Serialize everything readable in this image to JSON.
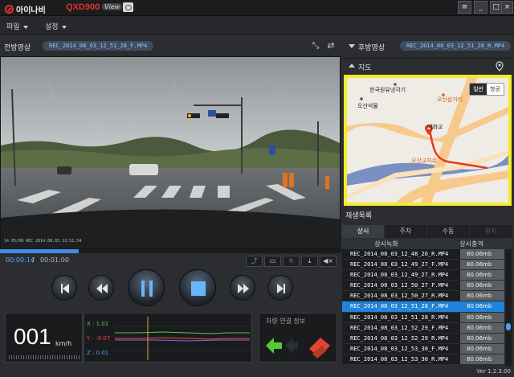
{
  "app": {
    "brand": "아이나비",
    "model": "QXD900",
    "model_suffix": "View",
    "version": "Ver 1.2.3.00"
  },
  "window_controls": {
    "menu": "≡",
    "minimize": "_",
    "maximize": "□",
    "close": "×"
  },
  "menu": {
    "file": "파일",
    "settings": "설정"
  },
  "front": {
    "label": "전방영상",
    "file": "REC_2014_08_03_12_51_28_F.MP4",
    "stamp": "14 05/08   REC 2014.08.03 12:51:34"
  },
  "playback": {
    "current": "00:00:14",
    "separator": "/",
    "total": "00:01:00",
    "progress": 0.23
  },
  "telemetry": {
    "speed": "001",
    "speed_unit": "km/h",
    "x": "X : 1.01",
    "y": "Y : -0.07",
    "z": "Z : 0.01",
    "vehicle_title": "차량 연결 정보"
  },
  "rear": {
    "label": "후방영상",
    "file": "REC_2014_08_03_12_51_28_R.MP4"
  },
  "map": {
    "label": "지도",
    "labels": {
      "place1": "한국원유냉각기",
      "place2": "오산석물",
      "place3": "오산삼거리",
      "place4": "예화교",
      "place5": "오산교차로"
    },
    "mode_normal": "일반",
    "mode_satellite": "항공",
    "colors": {
      "frame": "#f4eb2a",
      "route": "#e8391b",
      "water": "#7a8fc2",
      "road": "#f7c98b"
    }
  },
  "playlist": {
    "title": "재생목록",
    "tabs": [
      "상시",
      "주차",
      "수동",
      "위치"
    ],
    "columns": [
      "상시녹화",
      "상시충격"
    ],
    "rows": [
      {
        "name": "REC_2014_08_03_12_48_26_R.MP4",
        "size": "80.06mb"
      },
      {
        "name": "REC_2014_08_03_12_49_27_F.MP4",
        "size": "80.06mb"
      },
      {
        "name": "REC_2014_08_03_12_49_27_R.MP4",
        "size": "80.06mb"
      },
      {
        "name": "REC_2014_08_03_12_50_27_F.MP4",
        "size": "80.06mb"
      },
      {
        "name": "REC_2014_08_03_12_50_27_R.MP4",
        "size": "80.06mb"
      },
      {
        "name": "REC_2014_08_03_12_51_28_F.MP4",
        "size": "80.06mb"
      },
      {
        "name": "REC_2014_08_03_12_51_28_R.MP4",
        "size": "80.06mb"
      },
      {
        "name": "REC_2014_08_03_12_52_29_F.MP4",
        "size": "80.06mb"
      },
      {
        "name": "REC_2014_08_03_12_52_29_R.MP4",
        "size": "80.06mb"
      },
      {
        "name": "REC_2014_08_03_12_53_30_F.MP4",
        "size": "80.06mb"
      },
      {
        "name": "REC_2014_08_03_12_53_30_R.MP4",
        "size": "80.06mb"
      }
    ],
    "selected_index": 5
  }
}
